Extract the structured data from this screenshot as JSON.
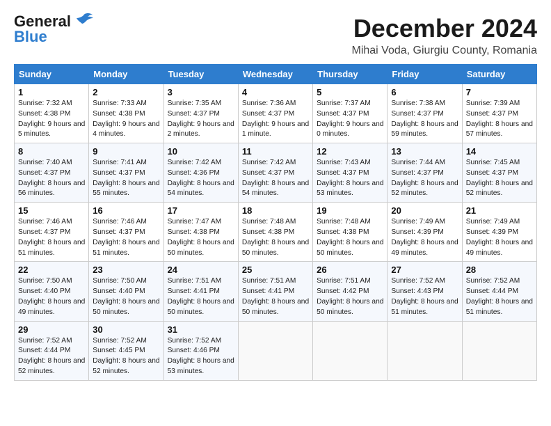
{
  "logo": {
    "line1": "General",
    "line2": "Blue"
  },
  "title": {
    "month": "December 2024",
    "location": "Mihai Voda, Giurgiu County, Romania"
  },
  "weekdays": [
    "Sunday",
    "Monday",
    "Tuesday",
    "Wednesday",
    "Thursday",
    "Friday",
    "Saturday"
  ],
  "weeks": [
    [
      {
        "day": "1",
        "sunrise": "7:32 AM",
        "sunset": "4:38 PM",
        "daylight": "9 hours and 5 minutes."
      },
      {
        "day": "2",
        "sunrise": "7:33 AM",
        "sunset": "4:38 PM",
        "daylight": "9 hours and 4 minutes."
      },
      {
        "day": "3",
        "sunrise": "7:35 AM",
        "sunset": "4:37 PM",
        "daylight": "9 hours and 2 minutes."
      },
      {
        "day": "4",
        "sunrise": "7:36 AM",
        "sunset": "4:37 PM",
        "daylight": "9 hours and 1 minute."
      },
      {
        "day": "5",
        "sunrise": "7:37 AM",
        "sunset": "4:37 PM",
        "daylight": "9 hours and 0 minutes."
      },
      {
        "day": "6",
        "sunrise": "7:38 AM",
        "sunset": "4:37 PM",
        "daylight": "8 hours and 59 minutes."
      },
      {
        "day": "7",
        "sunrise": "7:39 AM",
        "sunset": "4:37 PM",
        "daylight": "8 hours and 57 minutes."
      }
    ],
    [
      {
        "day": "8",
        "sunrise": "7:40 AM",
        "sunset": "4:37 PM",
        "daylight": "8 hours and 56 minutes."
      },
      {
        "day": "9",
        "sunrise": "7:41 AM",
        "sunset": "4:37 PM",
        "daylight": "8 hours and 55 minutes."
      },
      {
        "day": "10",
        "sunrise": "7:42 AM",
        "sunset": "4:36 PM",
        "daylight": "8 hours and 54 minutes."
      },
      {
        "day": "11",
        "sunrise": "7:42 AM",
        "sunset": "4:37 PM",
        "daylight": "8 hours and 54 minutes."
      },
      {
        "day": "12",
        "sunrise": "7:43 AM",
        "sunset": "4:37 PM",
        "daylight": "8 hours and 53 minutes."
      },
      {
        "day": "13",
        "sunrise": "7:44 AM",
        "sunset": "4:37 PM",
        "daylight": "8 hours and 52 minutes."
      },
      {
        "day": "14",
        "sunrise": "7:45 AM",
        "sunset": "4:37 PM",
        "daylight": "8 hours and 52 minutes."
      }
    ],
    [
      {
        "day": "15",
        "sunrise": "7:46 AM",
        "sunset": "4:37 PM",
        "daylight": "8 hours and 51 minutes."
      },
      {
        "day": "16",
        "sunrise": "7:46 AM",
        "sunset": "4:37 PM",
        "daylight": "8 hours and 51 minutes."
      },
      {
        "day": "17",
        "sunrise": "7:47 AM",
        "sunset": "4:38 PM",
        "daylight": "8 hours and 50 minutes."
      },
      {
        "day": "18",
        "sunrise": "7:48 AM",
        "sunset": "4:38 PM",
        "daylight": "8 hours and 50 minutes."
      },
      {
        "day": "19",
        "sunrise": "7:48 AM",
        "sunset": "4:38 PM",
        "daylight": "8 hours and 50 minutes."
      },
      {
        "day": "20",
        "sunrise": "7:49 AM",
        "sunset": "4:39 PM",
        "daylight": "8 hours and 49 minutes."
      },
      {
        "day": "21",
        "sunrise": "7:49 AM",
        "sunset": "4:39 PM",
        "daylight": "8 hours and 49 minutes."
      }
    ],
    [
      {
        "day": "22",
        "sunrise": "7:50 AM",
        "sunset": "4:40 PM",
        "daylight": "8 hours and 49 minutes."
      },
      {
        "day": "23",
        "sunrise": "7:50 AM",
        "sunset": "4:40 PM",
        "daylight": "8 hours and 50 minutes."
      },
      {
        "day": "24",
        "sunrise": "7:51 AM",
        "sunset": "4:41 PM",
        "daylight": "8 hours and 50 minutes."
      },
      {
        "day": "25",
        "sunrise": "7:51 AM",
        "sunset": "4:41 PM",
        "daylight": "8 hours and 50 minutes."
      },
      {
        "day": "26",
        "sunrise": "7:51 AM",
        "sunset": "4:42 PM",
        "daylight": "8 hours and 50 minutes."
      },
      {
        "day": "27",
        "sunrise": "7:52 AM",
        "sunset": "4:43 PM",
        "daylight": "8 hours and 51 minutes."
      },
      {
        "day": "28",
        "sunrise": "7:52 AM",
        "sunset": "4:44 PM",
        "daylight": "8 hours and 51 minutes."
      }
    ],
    [
      {
        "day": "29",
        "sunrise": "7:52 AM",
        "sunset": "4:44 PM",
        "daylight": "8 hours and 52 minutes."
      },
      {
        "day": "30",
        "sunrise": "7:52 AM",
        "sunset": "4:45 PM",
        "daylight": "8 hours and 52 minutes."
      },
      {
        "day": "31",
        "sunrise": "7:52 AM",
        "sunset": "4:46 PM",
        "daylight": "8 hours and 53 minutes."
      },
      null,
      null,
      null,
      null
    ]
  ]
}
